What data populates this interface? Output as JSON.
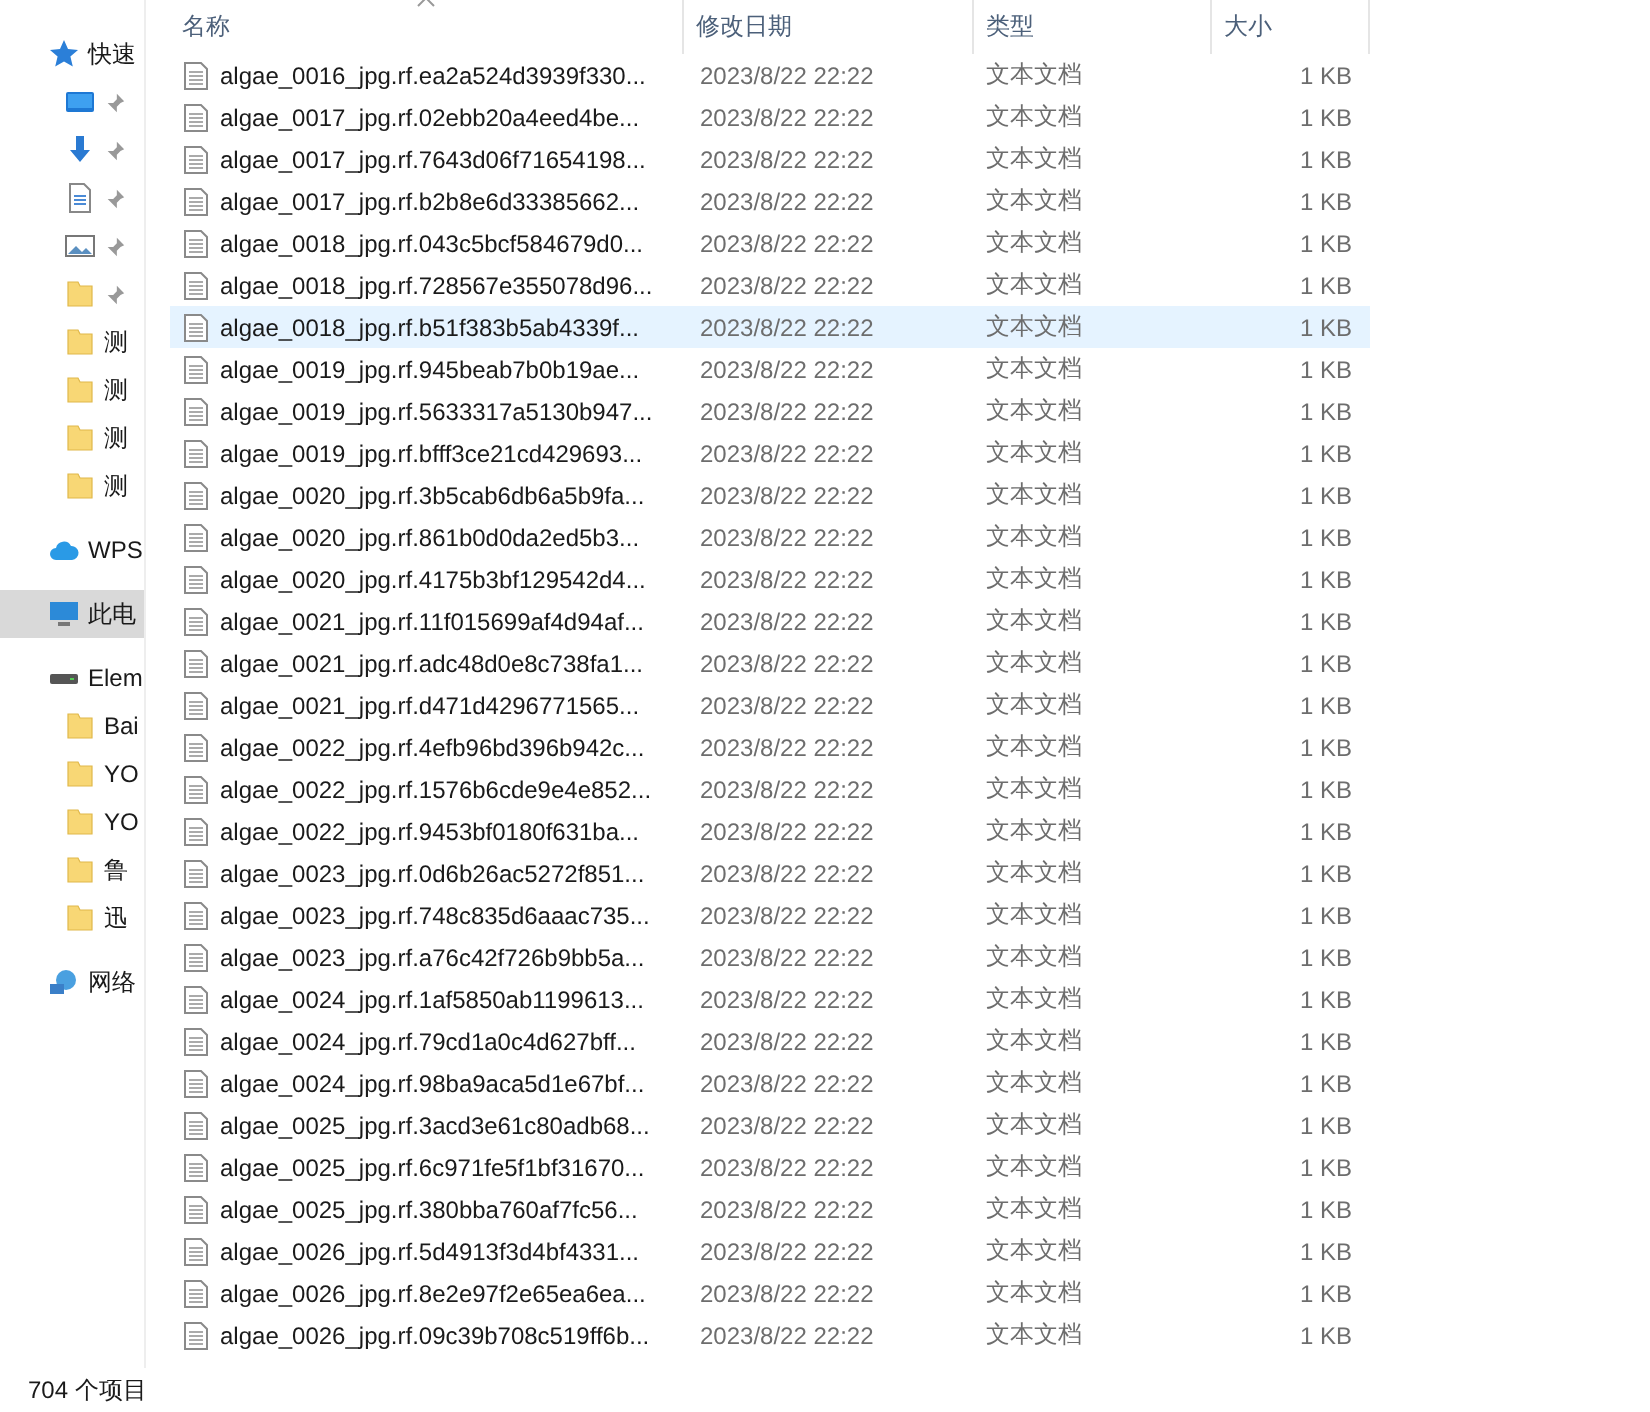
{
  "sidebar": {
    "items": [
      {
        "kind": "star",
        "label": "快速",
        "selected": false,
        "children": [
          {
            "kind": "desktop",
            "pinned": true,
            "selected": false
          },
          {
            "kind": "download",
            "pinned": true,
            "selected": false
          },
          {
            "kind": "document",
            "pinned": true,
            "selected": false
          },
          {
            "kind": "image",
            "pinned": true,
            "selected": false
          },
          {
            "kind": "folder",
            "pinned": true,
            "selected": false
          },
          {
            "kind": "folder",
            "label": "测",
            "pinned": false,
            "selected": false
          },
          {
            "kind": "folder",
            "label": "测",
            "pinned": false,
            "selected": false
          },
          {
            "kind": "folder",
            "label": "测",
            "pinned": false,
            "selected": false
          },
          {
            "kind": "folder",
            "label": "测",
            "pinned": false,
            "selected": false
          }
        ]
      },
      {
        "kind": "cloud",
        "label": "WPS",
        "selected": false
      },
      {
        "kind": "pc",
        "label": "此电",
        "selected": true
      },
      {
        "kind": "drive",
        "label": "Elem",
        "selected": false,
        "children": [
          {
            "kind": "folder",
            "label": "Bai",
            "selected": false
          },
          {
            "kind": "folder",
            "label": "YO",
            "selected": false
          },
          {
            "kind": "folder",
            "label": "YO",
            "selected": false
          },
          {
            "kind": "folder",
            "label": "鲁",
            "selected": false
          },
          {
            "kind": "folder",
            "label": "迅",
            "selected": false
          }
        ]
      },
      {
        "kind": "network",
        "label": "网络",
        "selected": false
      }
    ]
  },
  "table": {
    "columns": [
      {
        "label": "名称",
        "sorted": true
      },
      {
        "label": "修改日期",
        "sorted": false
      },
      {
        "label": "类型",
        "sorted": false
      },
      {
        "label": "大小",
        "sorted": false
      }
    ],
    "rows": [
      {
        "name": "algae_0016_jpg.rf.ea2a524d3939f330...",
        "date": "2023/8/22 22:22",
        "type": "文本文档",
        "size": "1 KB",
        "selected": false
      },
      {
        "name": "algae_0017_jpg.rf.02ebb20a4eed4be...",
        "date": "2023/8/22 22:22",
        "type": "文本文档",
        "size": "1 KB",
        "selected": false
      },
      {
        "name": "algae_0017_jpg.rf.7643d06f71654198...",
        "date": "2023/8/22 22:22",
        "type": "文本文档",
        "size": "1 KB",
        "selected": false
      },
      {
        "name": "algae_0017_jpg.rf.b2b8e6d33385662...",
        "date": "2023/8/22 22:22",
        "type": "文本文档",
        "size": "1 KB",
        "selected": false
      },
      {
        "name": "algae_0018_jpg.rf.043c5bcf584679d0...",
        "date": "2023/8/22 22:22",
        "type": "文本文档",
        "size": "1 KB",
        "selected": false
      },
      {
        "name": "algae_0018_jpg.rf.728567e355078d96...",
        "date": "2023/8/22 22:22",
        "type": "文本文档",
        "size": "1 KB",
        "selected": false
      },
      {
        "name": "algae_0018_jpg.rf.b51f383b5ab4339f...",
        "date": "2023/8/22 22:22",
        "type": "文本文档",
        "size": "1 KB",
        "selected": true
      },
      {
        "name": "algae_0019_jpg.rf.945beab7b0b19ae...",
        "date": "2023/8/22 22:22",
        "type": "文本文档",
        "size": "1 KB",
        "selected": false
      },
      {
        "name": "algae_0019_jpg.rf.5633317a5130b947...",
        "date": "2023/8/22 22:22",
        "type": "文本文档",
        "size": "1 KB",
        "selected": false
      },
      {
        "name": "algae_0019_jpg.rf.bfff3ce21cd429693...",
        "date": "2023/8/22 22:22",
        "type": "文本文档",
        "size": "1 KB",
        "selected": false
      },
      {
        "name": "algae_0020_jpg.rf.3b5cab6db6a5b9fa...",
        "date": "2023/8/22 22:22",
        "type": "文本文档",
        "size": "1 KB",
        "selected": false
      },
      {
        "name": "algae_0020_jpg.rf.861b0d0da2ed5b3...",
        "date": "2023/8/22 22:22",
        "type": "文本文档",
        "size": "1 KB",
        "selected": false
      },
      {
        "name": "algae_0020_jpg.rf.4175b3bf129542d4...",
        "date": "2023/8/22 22:22",
        "type": "文本文档",
        "size": "1 KB",
        "selected": false
      },
      {
        "name": "algae_0021_jpg.rf.11f015699af4d94af...",
        "date": "2023/8/22 22:22",
        "type": "文本文档",
        "size": "1 KB",
        "selected": false
      },
      {
        "name": "algae_0021_jpg.rf.adc48d0e8c738fa1...",
        "date": "2023/8/22 22:22",
        "type": "文本文档",
        "size": "1 KB",
        "selected": false
      },
      {
        "name": "algae_0021_jpg.rf.d471d4296771565...",
        "date": "2023/8/22 22:22",
        "type": "文本文档",
        "size": "1 KB",
        "selected": false
      },
      {
        "name": "algae_0022_jpg.rf.4efb96bd396b942c...",
        "date": "2023/8/22 22:22",
        "type": "文本文档",
        "size": "1 KB",
        "selected": false
      },
      {
        "name": "algae_0022_jpg.rf.1576b6cde9e4e852...",
        "date": "2023/8/22 22:22",
        "type": "文本文档",
        "size": "1 KB",
        "selected": false
      },
      {
        "name": "algae_0022_jpg.rf.9453bf0180f631ba...",
        "date": "2023/8/22 22:22",
        "type": "文本文档",
        "size": "1 KB",
        "selected": false
      },
      {
        "name": "algae_0023_jpg.rf.0d6b26ac5272f851...",
        "date": "2023/8/22 22:22",
        "type": "文本文档",
        "size": "1 KB",
        "selected": false
      },
      {
        "name": "algae_0023_jpg.rf.748c835d6aaac735...",
        "date": "2023/8/22 22:22",
        "type": "文本文档",
        "size": "1 KB",
        "selected": false
      },
      {
        "name": "algae_0023_jpg.rf.a76c42f726b9bb5a...",
        "date": "2023/8/22 22:22",
        "type": "文本文档",
        "size": "1 KB",
        "selected": false
      },
      {
        "name": "algae_0024_jpg.rf.1af5850ab1199613...",
        "date": "2023/8/22 22:22",
        "type": "文本文档",
        "size": "1 KB",
        "selected": false
      },
      {
        "name": "algae_0024_jpg.rf.79cd1a0c4d627bff...",
        "date": "2023/8/22 22:22",
        "type": "文本文档",
        "size": "1 KB",
        "selected": false
      },
      {
        "name": "algae_0024_jpg.rf.98ba9aca5d1e67bf...",
        "date": "2023/8/22 22:22",
        "type": "文本文档",
        "size": "1 KB",
        "selected": false
      },
      {
        "name": "algae_0025_jpg.rf.3acd3e61c80adb68...",
        "date": "2023/8/22 22:22",
        "type": "文本文档",
        "size": "1 KB",
        "selected": false
      },
      {
        "name": "algae_0025_jpg.rf.6c971fe5f1bf31670...",
        "date": "2023/8/22 22:22",
        "type": "文本文档",
        "size": "1 KB",
        "selected": false
      },
      {
        "name": "algae_0025_jpg.rf.380bba760af7fc56...",
        "date": "2023/8/22 22:22",
        "type": "文本文档",
        "size": "1 KB",
        "selected": false
      },
      {
        "name": "algae_0026_jpg.rf.5d4913f3d4bf4331...",
        "date": "2023/8/22 22:22",
        "type": "文本文档",
        "size": "1 KB",
        "selected": false
      },
      {
        "name": "algae_0026_jpg.rf.8e2e97f2e65ea6ea...",
        "date": "2023/8/22 22:22",
        "type": "文本文档",
        "size": "1 KB",
        "selected": false
      },
      {
        "name": "algae_0026_jpg.rf.09c39b708c519ff6b...",
        "date": "2023/8/22 22:22",
        "type": "文本文档",
        "size": "1 KB",
        "selected": false
      }
    ]
  },
  "status_bar": {
    "item_count": "704 个项目"
  }
}
